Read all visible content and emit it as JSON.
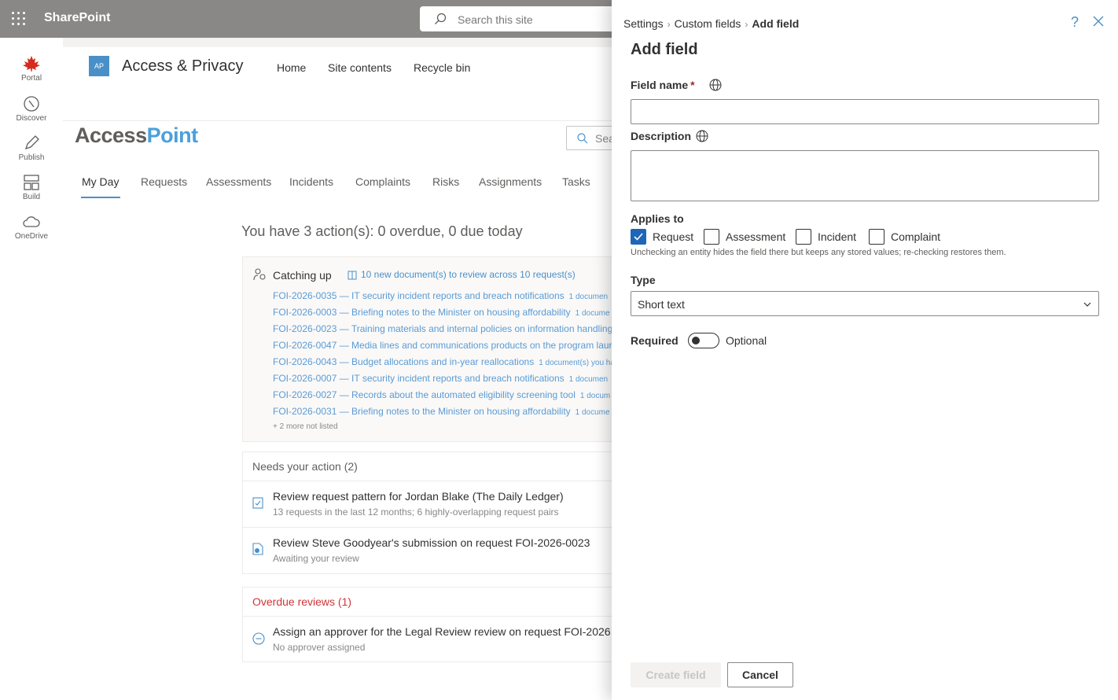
{
  "suite": {
    "app_name": "SharePoint",
    "search_placeholder": "Search this site"
  },
  "appbar": {
    "items": [
      {
        "label": "Portal",
        "icon": "maple-leaf-icon"
      },
      {
        "label": "Discover",
        "icon": "compass-icon"
      },
      {
        "label": "Publish",
        "icon": "pen-icon"
      },
      {
        "label": "Build",
        "icon": "layout-icon"
      },
      {
        "label": "OneDrive",
        "icon": "cloud-icon"
      }
    ]
  },
  "site": {
    "logo_initials": "AP",
    "title": "Access & Privacy",
    "nav": [
      "Home",
      "Site contents",
      "Recycle bin"
    ],
    "brand_part1": "Access",
    "brand_part2": "Point",
    "search_partial": "Sea"
  },
  "tabs": [
    "My Day",
    "Requests",
    "Assessments",
    "Incidents",
    "Complaints",
    "Risks",
    "Assignments",
    "Tasks"
  ],
  "summary": "You have 3 action(s): 0 overdue, 0 due today",
  "catching_up": {
    "title": "Catching up",
    "link": "10 new document(s) to review across 10 request(s)",
    "rows": [
      {
        "link": "FOI-2026-0035 — IT security incident reports and breach notifications",
        "docs": "1 documen"
      },
      {
        "link": "FOI-2026-0003 — Briefing notes to the Minister on housing affordability",
        "docs": "1 docume"
      },
      {
        "link": "FOI-2026-0023 — Training materials and internal policies on information handling",
        "docs": ""
      },
      {
        "link": "FOI-2026-0047 — Media lines and communications products on the program laur",
        "docs": ""
      },
      {
        "link": "FOI-2026-0043 — Budget allocations and in-year reallocations",
        "docs": "1 document(s) you ha"
      },
      {
        "link": "FOI-2026-0007 — IT security incident reports and breach notifications",
        "docs": "1 documen"
      },
      {
        "link": "FOI-2026-0027 — Records about the automated eligibility screening tool",
        "docs": "1 docum"
      },
      {
        "link": "FOI-2026-0031 — Briefing notes to the Minister on housing affordability",
        "docs": "1 docume"
      }
    ],
    "more": "+ 2 more not listed"
  },
  "needs_action": {
    "title": "Needs your action (2)",
    "items": [
      {
        "title": "Review request pattern for Jordan Blake (The Daily Ledger)",
        "sub": "13 requests in the last 12 months; 6 highly-overlapping request pairs"
      },
      {
        "title": "Review Steve Goodyear's submission on request FOI-2026-0023",
        "sub": "Awaiting your review"
      }
    ]
  },
  "overdue": {
    "title": "Overdue reviews (1)",
    "items": [
      {
        "title": "Assign an approver for the Legal Review review on request FOI-2026",
        "sub": "No approver assigned"
      }
    ]
  },
  "panel": {
    "breadcrumb": [
      "Settings",
      "Custom fields",
      "Add field"
    ],
    "title": "Add field",
    "field_name_label": "Field name",
    "required_mark": "*",
    "field_name_value": "",
    "description_label": "Description",
    "description_value": "",
    "applies_to_label": "Applies to",
    "entities": [
      {
        "label": "Request",
        "checked": true
      },
      {
        "label": "Assessment",
        "checked": false
      },
      {
        "label": "Incident",
        "checked": false
      },
      {
        "label": "Complaint",
        "checked": false
      }
    ],
    "applies_hint": "Unchecking an entity hides the field there but keeps any stored values; re-checking restores them.",
    "type_label": "Type",
    "type_value": "Short text",
    "required_label": "Required",
    "required_state": "Optional",
    "create_button": "Create field",
    "cancel_button": "Cancel",
    "help_glyph": "?"
  },
  "colors": {
    "accent": "#4a90c8",
    "link": "#5a9bd4",
    "checkbox": "#1f66b8",
    "overdue": "#d13438",
    "suitebar": "#8a8886"
  }
}
